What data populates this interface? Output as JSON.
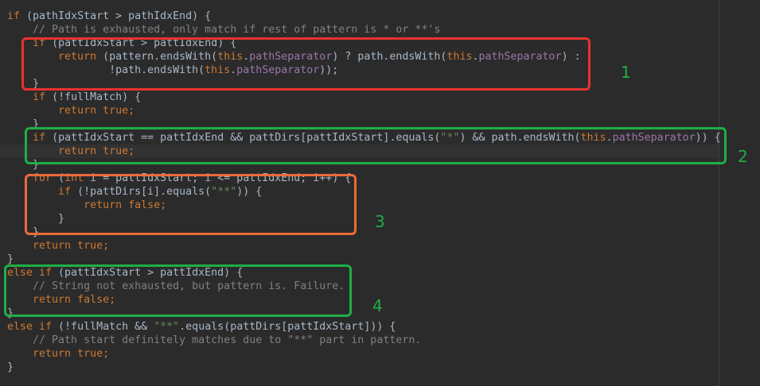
{
  "code_lines": [
    [
      {
        "t": "if ",
        "c": "kw"
      },
      {
        "t": "(pathIdxStart > pathIdxEnd) {",
        "c": "plain"
      }
    ],
    [
      {
        "t": "    // Path is exhausted, only match if rest of pattern is * or **'s",
        "c": "cmt"
      }
    ],
    [
      {
        "t": "    ",
        "c": "plain"
      },
      {
        "t": "if ",
        "c": "kw"
      },
      {
        "t": "(pattIdxStart > pattIdxEnd) {",
        "c": "plain"
      }
    ],
    [
      {
        "t": "        ",
        "c": "plain"
      },
      {
        "t": "return ",
        "c": "kw"
      },
      {
        "t": "(pattern.endsWith(",
        "c": "plain"
      },
      {
        "t": "this",
        "c": "kw"
      },
      {
        "t": ".",
        "c": "plain"
      },
      {
        "t": "pathSeparator",
        "c": "field"
      },
      {
        "t": ") ? path.endsWith(",
        "c": "plain"
      },
      {
        "t": "this",
        "c": "kw"
      },
      {
        "t": ".",
        "c": "plain"
      },
      {
        "t": "pathSeparator",
        "c": "field"
      },
      {
        "t": ") :",
        "c": "plain"
      }
    ],
    [
      {
        "t": "                !path.endsWith(",
        "c": "plain"
      },
      {
        "t": "this",
        "c": "kw"
      },
      {
        "t": ".",
        "c": "plain"
      },
      {
        "t": "pathSeparator",
        "c": "field"
      },
      {
        "t": "));",
        "c": "plain"
      }
    ],
    [
      {
        "t": "    }",
        "c": "plain"
      }
    ],
    [
      {
        "t": "    ",
        "c": "plain"
      },
      {
        "t": "if ",
        "c": "kw"
      },
      {
        "t": "(!fullMatch) {",
        "c": "plain"
      }
    ],
    [
      {
        "t": "        ",
        "c": "plain"
      },
      {
        "t": "return true;",
        "c": "kw"
      }
    ],
    [
      {
        "t": "    }",
        "c": "plain"
      }
    ],
    [
      {
        "t": "    ",
        "c": "plain"
      },
      {
        "t": "if ",
        "c": "kw"
      },
      {
        "t": "(pattIdxStart == pattIdxEnd && pattDirs[pattIdxStart].equals(",
        "c": "plain"
      },
      {
        "t": "\"*\"",
        "c": "str"
      },
      {
        "t": ") && path.endsWith(",
        "c": "plain"
      },
      {
        "t": "this",
        "c": "kw"
      },
      {
        "t": ".",
        "c": "plain"
      },
      {
        "t": "pathSeparator",
        "c": "field"
      },
      {
        "t": ")) {",
        "c": "plain"
      }
    ],
    [
      {
        "t": "        ",
        "c": "plain"
      },
      {
        "t": "return true;",
        "c": "kw"
      }
    ],
    [
      {
        "t": "    }",
        "c": "plain"
      }
    ],
    [
      {
        "t": "    ",
        "c": "plain"
      },
      {
        "t": "for ",
        "c": "kw"
      },
      {
        "t": "(",
        "c": "plain"
      },
      {
        "t": "int ",
        "c": "kw"
      },
      {
        "t": "i = pattIdxStart; i <= pattIdxEnd; i++) {",
        "c": "plain"
      }
    ],
    [
      {
        "t": "        ",
        "c": "plain"
      },
      {
        "t": "if ",
        "c": "kw"
      },
      {
        "t": "(!pattDirs[i].equals(",
        "c": "plain"
      },
      {
        "t": "\"**\"",
        "c": "str"
      },
      {
        "t": ")) {",
        "c": "plain"
      }
    ],
    [
      {
        "t": "            ",
        "c": "plain"
      },
      {
        "t": "return false;",
        "c": "kw"
      }
    ],
    [
      {
        "t": "        }",
        "c": "plain"
      }
    ],
    [
      {
        "t": "    }",
        "c": "plain"
      }
    ],
    [
      {
        "t": "    ",
        "c": "plain"
      },
      {
        "t": "return true;",
        "c": "kw"
      }
    ],
    [
      {
        "t": "}",
        "c": "plain"
      }
    ],
    [
      {
        "t": "else if ",
        "c": "kw"
      },
      {
        "t": "(pattIdxStart > pattIdxEnd) {",
        "c": "plain"
      }
    ],
    [
      {
        "t": "    // String not exhausted, but pattern is. Failure.",
        "c": "cmt"
      }
    ],
    [
      {
        "t": "    ",
        "c": "plain"
      },
      {
        "t": "return false;",
        "c": "kw"
      }
    ],
    [
      {
        "t": "}",
        "c": "plain"
      }
    ],
    [
      {
        "t": "else if ",
        "c": "kw"
      },
      {
        "t": "(!fullMatch && ",
        "c": "plain"
      },
      {
        "t": "\"**\"",
        "c": "str"
      },
      {
        "t": ".equals(pattDirs[pattIdxStart])) {",
        "c": "plain"
      }
    ],
    [
      {
        "t": "    // Path start definitely matches due to \"**\" part in pattern.",
        "c": "cmt"
      }
    ],
    [
      {
        "t": "    ",
        "c": "plain"
      },
      {
        "t": "return true;",
        "c": "kw"
      }
    ],
    [
      {
        "t": "}",
        "c": "plain"
      }
    ]
  ],
  "caret_line": 10,
  "colors": {
    "background": "#2b2b2b",
    "caret_row": "#323232",
    "keyword": "#cc7832",
    "identifier": "#a9b7c6",
    "field": "#9876aa",
    "string": "#6a8759",
    "comment": "#808080",
    "box_red": "#e8322e",
    "box_green": "#1fae46",
    "box_orange": "#ee6a3a"
  },
  "annotations": [
    {
      "id": "1",
      "label": "1",
      "color": "#1fae46"
    },
    {
      "id": "2",
      "label": "2",
      "color": "#1fae46"
    },
    {
      "id": "3",
      "label": "3",
      "color": "#1fae46"
    },
    {
      "id": "4",
      "label": "4",
      "color": "#1fae46"
    }
  ]
}
